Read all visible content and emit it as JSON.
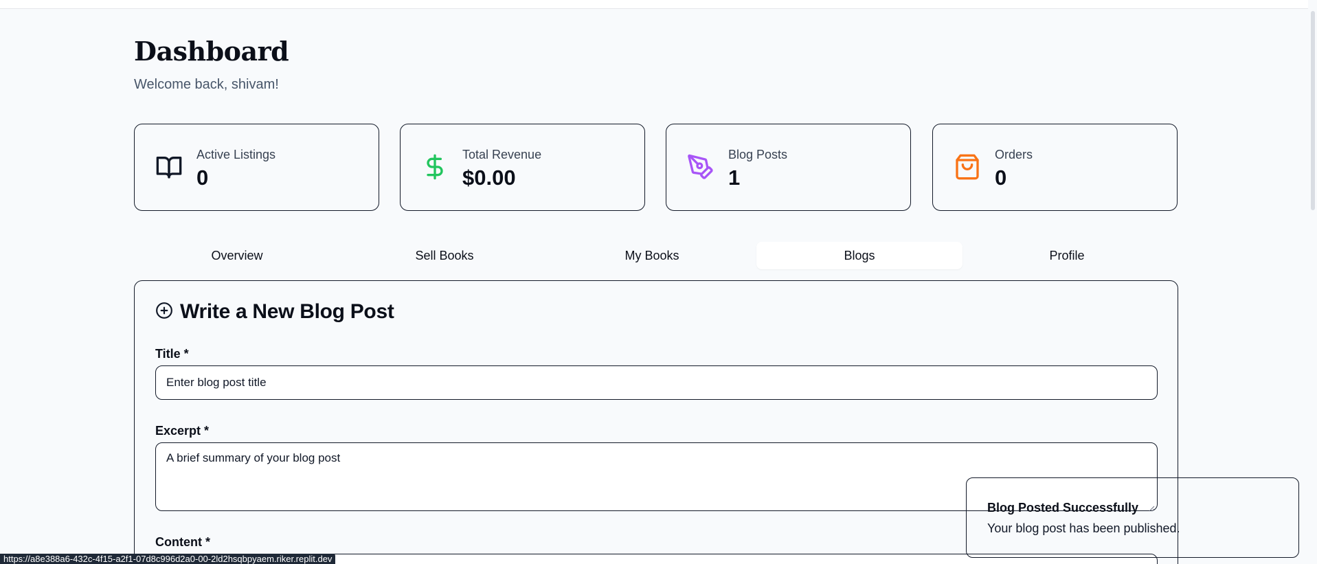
{
  "header": {
    "title": "Dashboard",
    "welcome": "Welcome back, shivam!"
  },
  "stats": [
    {
      "label": "Active Listings",
      "value": "0",
      "icon": "open-book-icon",
      "color": "#111827"
    },
    {
      "label": "Total Revenue",
      "value": "$0.00",
      "icon": "dollar-icon",
      "color": "#22c55e"
    },
    {
      "label": "Blog Posts",
      "value": "1",
      "icon": "pen-tool-icon",
      "color": "#a855f7"
    },
    {
      "label": "Orders",
      "value": "0",
      "icon": "shopping-bag-icon",
      "color": "#f97316"
    }
  ],
  "tabs": [
    {
      "label": "Overview"
    },
    {
      "label": "Sell Books"
    },
    {
      "label": "My Books"
    },
    {
      "label": "Blogs",
      "active": true
    },
    {
      "label": "Profile"
    }
  ],
  "form": {
    "heading": "Write a New Blog Post",
    "title_label": "Title *",
    "title_placeholder": "Enter blog post title",
    "excerpt_label": "Excerpt *",
    "excerpt_placeholder": "A brief summary of your blog post",
    "content_label": "Content *"
  },
  "toast": {
    "title": "Blog Posted Successfully",
    "message": "Your blog post has been published."
  },
  "status_bar": {
    "url": "https://a8e388a6-432c-4f15-a2f1-07d8c996d2a0-00-2ld2hsqbpyaem.riker.replit.dev"
  },
  "colors": {
    "background": "#f8fafc",
    "border": "#111827",
    "revenue_green": "#22c55e",
    "blog_purple": "#a855f7",
    "orders_orange": "#f97316"
  }
}
